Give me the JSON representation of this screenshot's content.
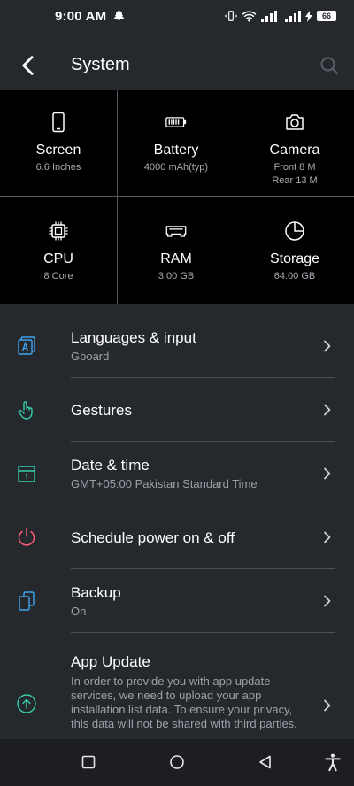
{
  "status": {
    "time": "9:00 AM",
    "battery": "66"
  },
  "header": {
    "title": "System"
  },
  "specs": [
    {
      "icon": "phone-screen-icon",
      "title": "Screen",
      "value": "6.6 Inches"
    },
    {
      "icon": "battery-icon",
      "title": "Battery",
      "value": "4000 mAh(typ)"
    },
    {
      "icon": "camera-icon",
      "title": "Camera",
      "value": "Front 8 M",
      "value2": "Rear 13 M"
    },
    {
      "icon": "cpu-chip-icon",
      "title": "CPU",
      "value": "8 Core"
    },
    {
      "icon": "ram-module-icon",
      "title": "RAM",
      "value": "3.00 GB"
    },
    {
      "icon": "storage-pie-icon",
      "title": "Storage",
      "value": "64.00 GB"
    }
  ],
  "settings": [
    {
      "title": "Languages & input",
      "sub": "Gboard",
      "color": "#3ea6f2"
    },
    {
      "title": "Gestures",
      "sub": "",
      "color": "#35d0a6"
    },
    {
      "title": "Date & time",
      "sub": "GMT+05:00 Pakistan Standard Time",
      "color": "#35d0a6"
    },
    {
      "title": "Schedule power on & off",
      "sub": "",
      "color": "#ff5a78"
    },
    {
      "title": "Backup",
      "sub": "On",
      "color": "#3ea6f2"
    },
    {
      "title": "App Update",
      "sub": "In order to provide you with app update services, we need to upload your app installation list data. To ensure your privacy, this data will not be shared with third parties.",
      "color": "#35d0a6"
    }
  ]
}
